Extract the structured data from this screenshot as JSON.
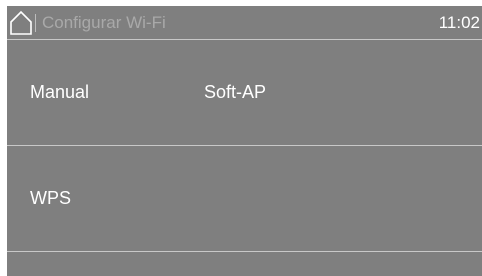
{
  "header": {
    "home_icon": "home-icon",
    "title": "Configurar Wi-Fi",
    "time": "11:02"
  },
  "options": {
    "manual": "Manual",
    "soft_ap": "Soft-AP",
    "wps": "WPS"
  },
  "colors": {
    "panel": "#7f7f7f",
    "divider": "#c8c8c8",
    "text": "#ffffff",
    "title_text": "#a9a9a9"
  }
}
